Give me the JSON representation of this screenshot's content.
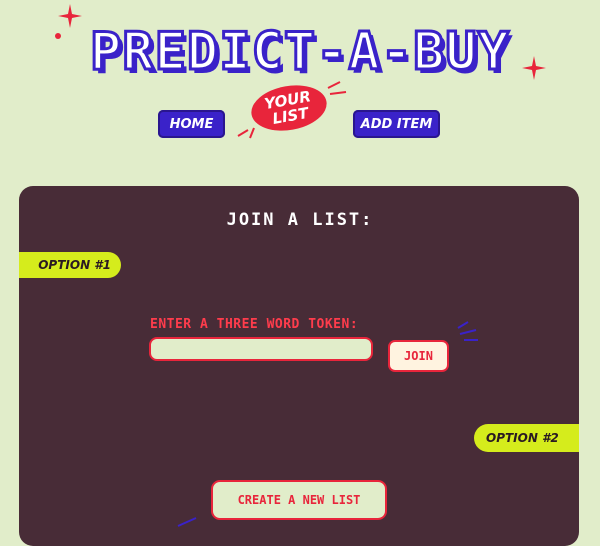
{
  "header": {
    "title": "PREDICT-A-BUY",
    "nav": {
      "home_label": "HOME",
      "your_list_line1": "YOUR",
      "your_list_line2": "LIST",
      "add_item_label": "ADD ITEM"
    }
  },
  "panel": {
    "title": "JOIN A LIST:",
    "option1_label": "OPTION #1",
    "option2_label": "OPTION #2",
    "token_label": "ENTER A THREE WORD TOKEN:",
    "token_input": {
      "value": "",
      "placeholder": ""
    },
    "join_label": "JOIN",
    "create_label": "CREATE A NEW LIST"
  },
  "colors": {
    "background": "#e1edca",
    "brand_blue": "#3a22c9",
    "accent_red": "#e8253b",
    "panel": "#482c37",
    "tag_yellow": "#d5ec1c"
  }
}
